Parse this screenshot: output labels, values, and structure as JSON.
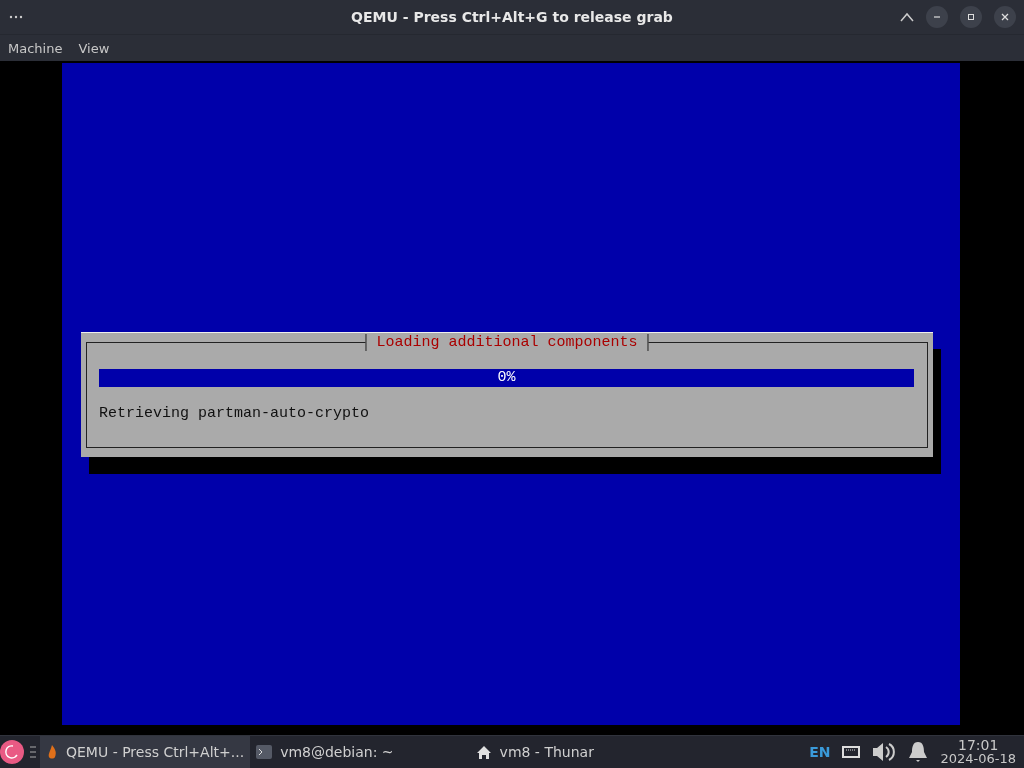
{
  "window": {
    "title": "QEMU - Press Ctrl+Alt+G to release grab"
  },
  "menu": [
    "Machine",
    "View"
  ],
  "dialog": {
    "title": "Loading additional components",
    "progress": {
      "level": 0,
      "reading": "0%"
    },
    "status": "Retrieving partman-auto-crypto"
  },
  "taskbar": {
    "tasks": [
      {
        "kind": "qemu",
        "label": "QEMU - Press Ctrl+Alt+...",
        "selected": true
      },
      {
        "kind": "terminal",
        "label": "vm8@debian: ~",
        "selected": false
      },
      {
        "kind": "files",
        "label": "vm8 - Thunar",
        "selected": false
      }
    ],
    "language": "EN",
    "time": "17:01",
    "date": "2024-06-18"
  }
}
